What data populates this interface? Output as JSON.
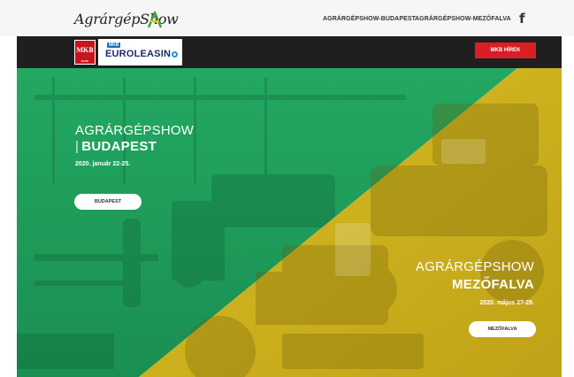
{
  "header": {
    "logo_text": "AgrárgépShow",
    "nav": [
      {
        "label": "AGRÁRGÉPSHOW-BUDAPEST"
      },
      {
        "label": "AGRÁRGÉPSHOW-MEZŐFALVA"
      }
    ],
    "social_icon": "facebook-icon",
    "social_glyph": "f"
  },
  "sponsors": {
    "mkb_logo_text": "MKB",
    "mkb_logo_small": "BANK",
    "euroleasing_top": "MKB",
    "euroleasing_name": "EUROLEASIN",
    "news_button": "MKB HÍREK"
  },
  "hero": {
    "budapest": {
      "title": "AGRÁRGÉPSHOW",
      "bar": "|",
      "subtitle": "BUDAPEST",
      "date": "2020. január 22-25.",
      "button": "BUDAPEST"
    },
    "mezofalva": {
      "title": "AGRÁRGÉPSHOW",
      "subtitle": "MEZŐFALVA",
      "date": "2020. május 27-28.",
      "button": "MEZŐFALVA"
    }
  },
  "colors": {
    "green_overlay": "#1e9e5a",
    "yellow_overlay": "#d6b81f",
    "news_red": "#d81f26",
    "sponsor_bar": "#1f1f1f"
  }
}
